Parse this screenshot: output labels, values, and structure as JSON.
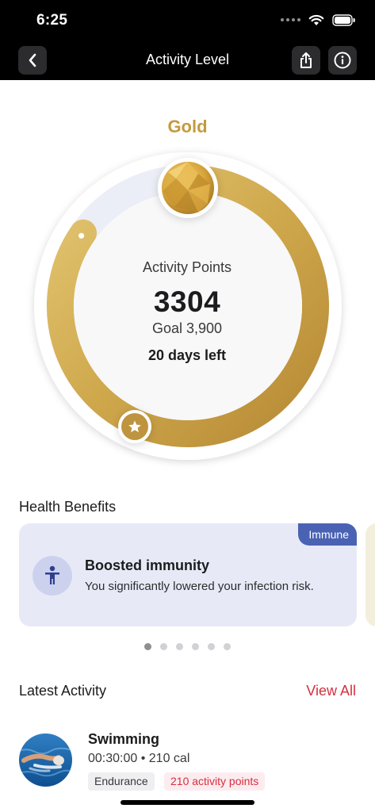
{
  "status_bar": {
    "time": "6:25"
  },
  "nav": {
    "title": "Activity Level"
  },
  "level": {
    "name": "Gold",
    "points_label": "Activity Points",
    "points": "3304",
    "goal_text": "Goal 3,900",
    "days_left": "20 days left",
    "points_value": 3304,
    "goal_value": 3900,
    "progress_fraction": 0.847
  },
  "health_benefits": {
    "title": "Health Benefits",
    "card": {
      "tag": "Immune",
      "title": "Boosted immunity",
      "description": "You significantly lowered your infection risk."
    },
    "pager": {
      "count": 6,
      "active_index": 0
    }
  },
  "latest_activity": {
    "title": "Latest Activity",
    "view_all": "View All",
    "items": [
      {
        "name": "Swimming",
        "meta": "00:30:00 • 210 cal",
        "tag": "Endurance",
        "points_tag": "210 activity points"
      }
    ]
  },
  "colors": {
    "gold": "#c49a3d",
    "track": "#ebeef6",
    "view_all": "#d62f3f",
    "immune_tag": "#4a62b4",
    "card_bg": "#e7eaf6"
  }
}
